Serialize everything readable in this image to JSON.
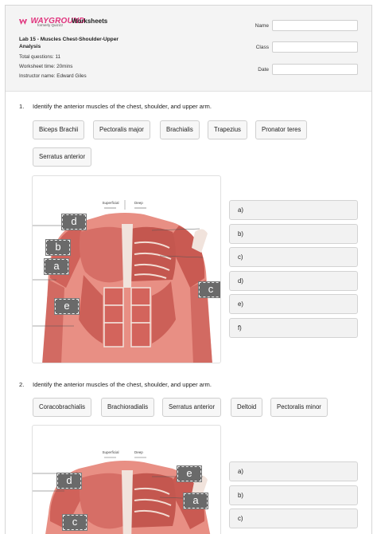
{
  "brand": {
    "name": "WAYGROUND",
    "sub": "formerly Quizizz",
    "doc_type": "Worksheets"
  },
  "worksheet": {
    "title": "Lab 15 - Muscles Chest-Shoulder-Upper Analysis",
    "total_questions": "Total questions: 11",
    "time": "Worksheet time: 20mins",
    "instructor": "Instructor name: Edward Giles"
  },
  "fields": {
    "name": "Name",
    "class": "Class",
    "date": "Date"
  },
  "questions": [
    {
      "number": "1.",
      "text": "Identify the anterior muscles of the chest, shoulder, and upper arm.",
      "options": [
        "Biceps Brachii",
        "Pectoralis major",
        "Brachialis",
        "Trapezius",
        "Pronator teres",
        "Serratus anterior"
      ],
      "answers": [
        "a)",
        "b)",
        "c)",
        "d)",
        "e)",
        "f)"
      ],
      "image": {
        "superficial": "Superficial",
        "deep": "Deep",
        "labels": [
          "d",
          "b",
          "a",
          "c",
          "e"
        ]
      }
    },
    {
      "number": "2.",
      "text": "Identify the anterior muscles of the chest, shoulder, and upper arm.",
      "options": [
        "Coracobrachialis",
        "Brachioradialis",
        "Serratus anterior",
        "Deltoid",
        "Pectoralis minor"
      ],
      "answers": [
        "a)",
        "b)",
        "c)"
      ],
      "image": {
        "superficial": "Superficial",
        "deep": "Deep",
        "labels": [
          "d",
          "e",
          "a",
          "c"
        ]
      }
    }
  ],
  "colors": {
    "brand": "#e0317c",
    "muscle": "#d9726a",
    "tendon": "#f1e3dc",
    "label_bg": "#6a6a6a"
  }
}
